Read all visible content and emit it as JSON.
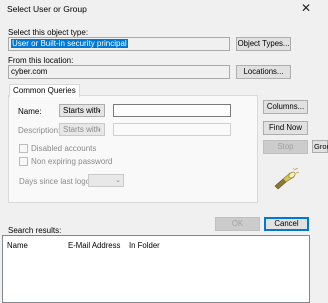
{
  "window": {
    "title": "Select User or Group",
    "close_glyph": "✕"
  },
  "object_type": {
    "label": "Select this object type:",
    "value": "User or Built-in security principal",
    "button": "Object Types..."
  },
  "location": {
    "label": "From this location:",
    "value": "cyber.com",
    "button": "Locations..."
  },
  "tabs": [
    "Common Queries"
  ],
  "queries": {
    "name_label": "Name:",
    "name_mode": "Starts with",
    "name_value": "",
    "description_label": "Description:",
    "description_mode": "Starts with",
    "description_value": "",
    "disabled_accounts": "Disabled accounts",
    "non_expiring_password": "Non expiring password",
    "days_label": "Days since last logon:",
    "days_value": ""
  },
  "side_buttons": {
    "columns": "Columns...",
    "find_now": "Find Now",
    "stop": "Stop"
  },
  "bottom_buttons": {
    "ok": "OK",
    "cancel": "Cancel"
  },
  "results": {
    "label": "Search results:",
    "columns": [
      "Name",
      "E-Mail Address",
      "In Folder"
    ]
  },
  "background": {
    "group_fragment": "Grou"
  },
  "icons": {
    "close": "close-icon",
    "search": "search-flashlight-icon",
    "dropdown": "chevron-down-icon"
  }
}
